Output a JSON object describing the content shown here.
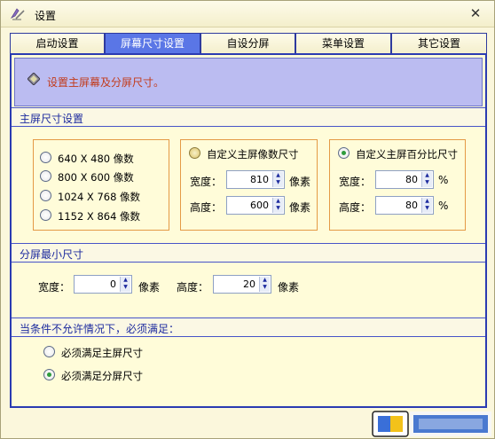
{
  "window": {
    "title": "设置",
    "close_glyph": "✕"
  },
  "tabs": [
    {
      "label": "启动设置",
      "active": false
    },
    {
      "label": "屏幕尺寸设置",
      "active": true
    },
    {
      "label": "自设分屏",
      "active": false
    },
    {
      "label": "菜单设置",
      "active": false
    },
    {
      "label": "其它设置",
      "active": false
    }
  ],
  "header": {
    "text": "设置主屏幕及分屏尺寸。"
  },
  "main_size": {
    "section_title": "主屏尺寸设置",
    "presets": [
      {
        "label": "640 X 480 像数",
        "checked": false
      },
      {
        "label": "800 X 600 像数",
        "checked": false
      },
      {
        "label": "1024 X 768 像数",
        "checked": false
      },
      {
        "label": "1152 X 864 像数",
        "checked": false
      }
    ],
    "custom_pixels": {
      "label": "自定义主屏像数尺寸",
      "checked": false,
      "width_label": "宽度：",
      "width_value": "810",
      "width_unit": "像素",
      "height_label": "高度：",
      "height_value": "600",
      "height_unit": "像素"
    },
    "custom_percent": {
      "label": "自定义主屏百分比尺寸",
      "checked": true,
      "width_label": "宽度：",
      "width_value": "80",
      "width_unit": "%",
      "height_label": "高度：",
      "height_value": "80",
      "height_unit": "%"
    }
  },
  "split_min": {
    "section_title": "分屏最小尺寸",
    "width_label": "宽度：",
    "width_value": "0",
    "width_unit": "像素",
    "height_label": "高度：",
    "height_value": "20",
    "height_unit": "像素"
  },
  "constraint": {
    "section_title": "当条件不允许情况下，必须满足：",
    "options": [
      {
        "label": "必须满足主屏尺寸",
        "checked": false
      },
      {
        "label": "必须满足分屏尺寸",
        "checked": true
      }
    ]
  },
  "colors": {
    "accent": "#5a76e6",
    "border": "#2b3bb2",
    "header_band": "#bbbcf1",
    "hint_text": "#c23b1b",
    "group_border": "#e49a46"
  }
}
